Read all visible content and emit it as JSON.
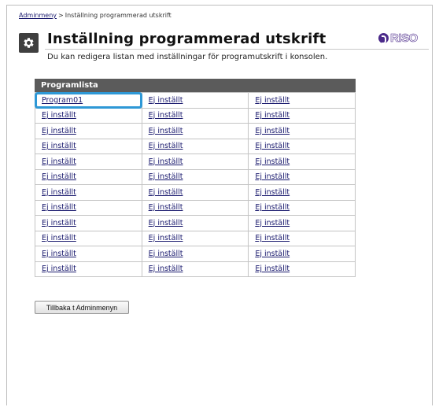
{
  "breadcrumb": {
    "root": "Adminmeny",
    "separator": ">",
    "current": "Inställning programmerad utskrift"
  },
  "page": {
    "title": "Inställning programmerad utskrift",
    "subtitle": "Du kan redigera listan med inställningar för programutskrift i konsolen.",
    "title_icon": "gear-icon"
  },
  "brand": {
    "logo_text": "RISO",
    "color": "#4b2a8a"
  },
  "program_list": {
    "header": "Programlista",
    "selected_color": "#2e98d6",
    "rows": [
      [
        "Program01",
        "Ej inställt",
        "Ej inställt"
      ],
      [
        "Ej inställt",
        "Ej inställt",
        "Ej inställt"
      ],
      [
        "Ej inställt",
        "Ej inställt",
        "Ej inställt"
      ],
      [
        "Ej inställt",
        "Ej inställt",
        "Ej inställt"
      ],
      [
        "Ej inställt",
        "Ej inställt",
        "Ej inställt"
      ],
      [
        "Ej inställt",
        "Ej inställt",
        "Ej inställt"
      ],
      [
        "Ej inställt",
        "Ej inställt",
        "Ej inställt"
      ],
      [
        "Ej inställt",
        "Ej inställt",
        "Ej inställt"
      ],
      [
        "Ej inställt",
        "Ej inställt",
        "Ej inställt"
      ],
      [
        "Ej inställt",
        "Ej inställt",
        "Ej inställt"
      ],
      [
        "Ej inställt",
        "Ej inställt",
        "Ej inställt"
      ],
      [
        "Ej inställt",
        "Ej inställt",
        "Ej inställt"
      ]
    ]
  },
  "actions": {
    "back_label": "Tillbaka t Adminmenyn"
  }
}
